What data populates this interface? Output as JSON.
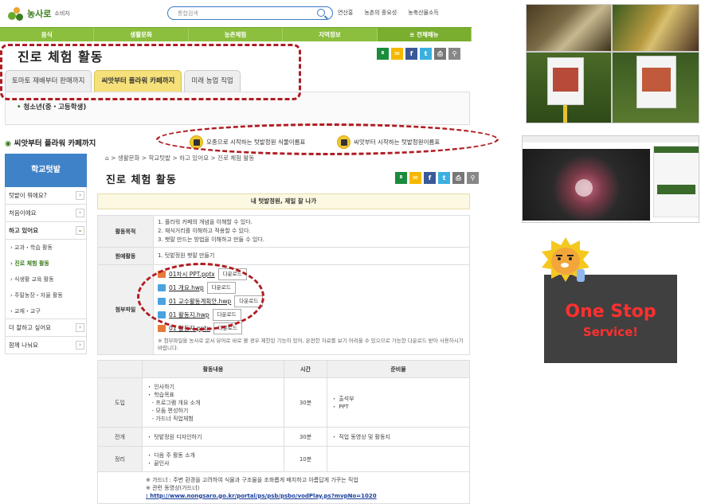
{
  "header": {
    "logo_text": "농사로",
    "logo_sub": "소비자",
    "search_placeholder": "통합검색",
    "top_links": [
      "연산홍",
      "농촌의 중요성",
      "농축산물소득"
    ]
  },
  "main_nav": [
    "음식",
    "생활문화",
    "농촌체험",
    "지역정보",
    "≡  전체메뉴"
  ],
  "page": {
    "title": "진로 체험 활동",
    "tabs": [
      "토마토 재배부터 판매까지",
      "씨앗부터 플라워 카페까지",
      "미래 농업 직업"
    ],
    "active_tab": 1,
    "audience": "청소년(중・고등학생)",
    "section_title": "씨앗부터 플라워 카페까지",
    "download_buttons": [
      "모종으로 시작하는 텃밭정원 식물이름표",
      "씨앗부터 시작하는 텃밭정원이름표"
    ]
  },
  "sidebar": {
    "head": "학교텃밭",
    "items": [
      {
        "label": "텃밭이 뭐에요?",
        "arrow": "›"
      },
      {
        "label": "처음이에요",
        "arrow": "›"
      },
      {
        "label": "하고 있어요",
        "arrow": "⌄"
      }
    ],
    "subitems": [
      "교과・학습 활동",
      "진로 체험 활동",
      "식생활 교육 활동",
      "주말농장・자율 활동",
      "교재・교구"
    ],
    "active_sub": 1,
    "items2": [
      {
        "label": "더 잘하고 싶어요",
        "arrow": "›"
      },
      {
        "label": "함께 나눠요",
        "arrow": "›"
      }
    ]
  },
  "content": {
    "breadcrumb": "⌂  >  생활문화  >  학교텃밭  >  하고 있어요  >  진로 체험 활동",
    "title": "진로 체험 활동",
    "banner": "내 텃밭정원, 제일 잘 나가",
    "table1": {
      "goal_label": "활동목적",
      "goals": [
        "1. 플라워 카페의 개념을 이해할 수 있다.",
        "2. 재식거리를 이해하고 적용할 수 있다.",
        "3. 팻말 만드는 방법을 이해하고 만들 수 있다."
      ],
      "garden_label": "원예활동",
      "garden": "1. 텃밭정원 팻말 만들기",
      "files_label": "첨부파일",
      "files": [
        {
          "name": "01차시 PPT.pptx",
          "type": "ppt"
        },
        {
          "name": "01 개요.hwp",
          "type": "hwp"
        },
        {
          "name": "01 교수활동계획안.hwp",
          "type": "hwp"
        },
        {
          "name": "01 활동지.hwp",
          "type": "hwp"
        },
        {
          "name": "01 활동지.pptx",
          "type": "ppt"
        }
      ],
      "download_label": "다운로드",
      "note": "※ 첨부파일을 농사로 문서 뷰어로 바로 볼 경우 제한된 기능이 있어, 온전한 자료를 보기 어려울 수 있으므로 가능한 다운로드 받아 사용하시기 바랍니다."
    },
    "table2": {
      "headers": [
        "활동내용",
        "시간",
        "준비물"
      ],
      "rows": [
        {
          "stage": "도입",
          "items": [
            "・ 인사하기",
            "・ 학습목표",
            "   - 프로그램 개요 소개",
            "   - 모둠 편성하기",
            "   - 가드너 직업체험"
          ],
          "time": "30분",
          "materials": [
            "・ 출석부",
            "・ PPT"
          ]
        },
        {
          "stage": "전개",
          "items": [
            "・ 텃밭정원 디자인하기"
          ],
          "time": "30분",
          "materials": [
            "・ 직업 동영상 및 활동지"
          ]
        },
        {
          "stage": "정리",
          "items": [
            "・ 다음 주 활동 소개",
            "・ 끝인사"
          ],
          "time": "10분",
          "materials": []
        }
      ],
      "note1": "※ 가드너 : 주변 환경을 고려하여 식물과 구조물을 조화롭게 배치하고 아름답게 가꾸는 직업",
      "note2": "※ 관련 동영상(가드너)",
      "link": "http://www.nongsaro.go.kr/portal/ps/psb/psbo/vodPlay.ps?mvpNo=1020"
    }
  },
  "right_panel": {
    "promo_line1": "One Stop",
    "promo_line2": "Service!"
  },
  "colors": {
    "green": "#8bbf3d",
    "blue": "#3f82c8",
    "red": "#b01c22",
    "promo_bg": "#404040",
    "promo_text": "#ff3030"
  }
}
